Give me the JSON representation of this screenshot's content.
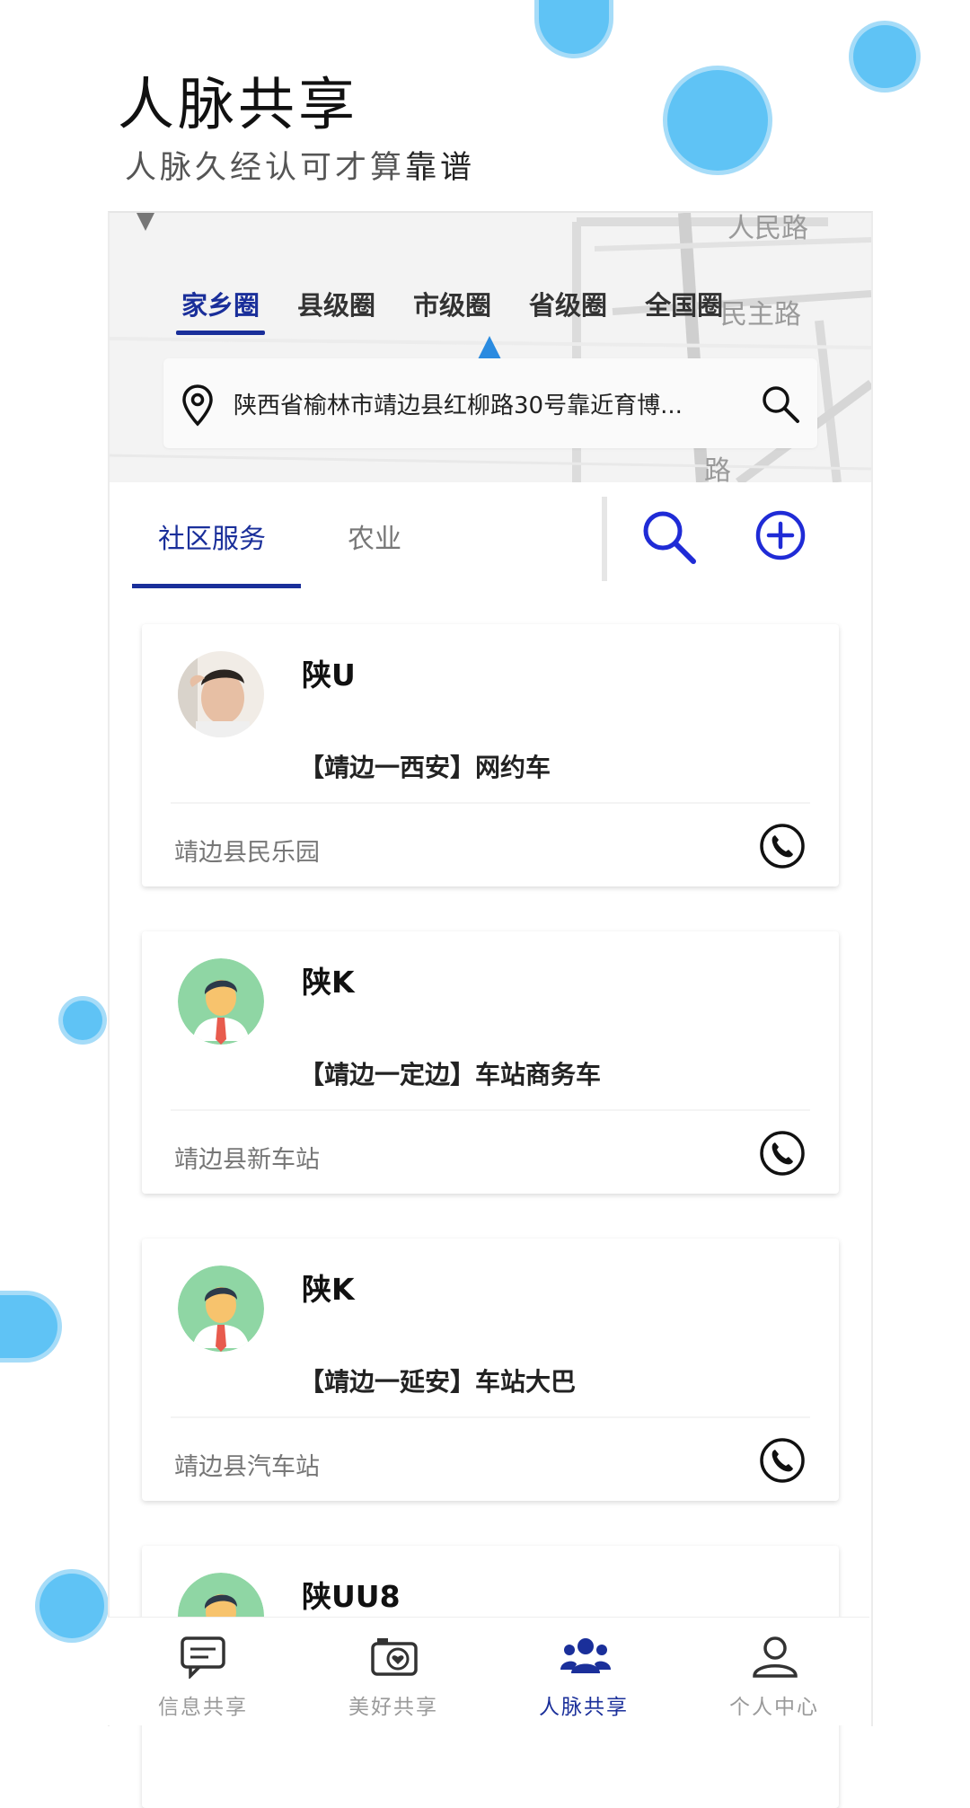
{
  "header": {
    "title": "人脉共享",
    "subtitle_main": "人脉久经认可才算",
    "subtitle_strong": "靠谱"
  },
  "map": {
    "labels": [
      "人民路",
      "民主路",
      "路"
    ],
    "region_tabs": [
      {
        "label": "家乡圈",
        "active": true
      },
      {
        "label": "县级圈",
        "active": false
      },
      {
        "label": "市级圈",
        "active": false
      },
      {
        "label": "省级圈",
        "active": false
      },
      {
        "label": "全国圈",
        "active": false
      }
    ],
    "address": "陕西省榆林市靖边县红柳路30号靠近育博..."
  },
  "category_tabs": [
    {
      "label": "社区服务",
      "active": true
    },
    {
      "label": "农业",
      "active": false
    }
  ],
  "cards": [
    {
      "name": "陕U",
      "route": "【靖边一西安】网约车",
      "location": "靖边县民乐园",
      "avatar": "photo-avatar"
    },
    {
      "name": "陕K",
      "route": "【靖边一定边】车站商务车",
      "location": "靖边县新车站",
      "avatar": "default-avatar"
    },
    {
      "name": "陕K",
      "route": "【靖边一延安】车站大巴",
      "location": "靖边县汽车站",
      "avatar": "default-avatar"
    },
    {
      "name": "陕UU8",
      "route": "",
      "location": "",
      "avatar": "default-avatar"
    }
  ],
  "bottom_nav": [
    {
      "label": "信息共享",
      "icon": "chat-icon",
      "active": false
    },
    {
      "label": "美好共享",
      "icon": "camera-heart-icon",
      "active": false
    },
    {
      "label": "人脉共享",
      "icon": "people-group-icon",
      "active": true
    },
    {
      "label": "个人中心",
      "icon": "person-icon",
      "active": false
    }
  ],
  "colors": {
    "accent": "#1a2f9a",
    "bubble": "#5fc3f5",
    "icon_blue": "#1f2bd6"
  }
}
